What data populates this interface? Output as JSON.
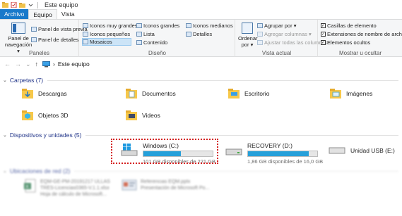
{
  "titlebar": {
    "title": "Este equipo"
  },
  "tabs": [
    {
      "label": "Archivo"
    },
    {
      "label": "Equipo"
    },
    {
      "label": "Vista"
    }
  ],
  "ribbon": {
    "paneles": {
      "label": "Paneles",
      "nav_pane": "Panel de navegación ▾",
      "preview": "Panel de vista previa",
      "details": "Panel de detalles"
    },
    "diseno": {
      "label": "Diseño",
      "items": [
        "Iconos muy grandes",
        "Iconos grandes",
        "Iconos medianos",
        "Iconos pequeños",
        "Lista",
        "Detalles",
        "Mosaicos",
        "Contenido"
      ]
    },
    "vista_actual": {
      "label": "Vista actual",
      "sort": "Ordenar por ▾",
      "group_by": "Agrupar por ▾",
      "add_columns": "Agregar columnas ▾",
      "fit_columns": "Ajustar todas las columnas"
    },
    "mostrar": {
      "label": "Mostrar u ocultar",
      "checkboxes": [
        {
          "label": "Casillas de elemento",
          "checked": true
        },
        {
          "label": "Extensiones de nombre de archivo",
          "checked": true
        },
        {
          "label": "Elementos ocultos",
          "checked": true
        }
      ]
    }
  },
  "address": {
    "path": "Este equipo"
  },
  "sections": {
    "folders": "Carpetas (7)",
    "drives": "Dispositivos y unidades (5)",
    "network": "Ubicaciones de red (2)"
  },
  "folders": [
    {
      "name": "Descargas",
      "icon": "downloads-folder-icon"
    },
    {
      "name": "Documentos",
      "icon": "documents-folder-icon"
    },
    {
      "name": "Escritorio",
      "icon": "desktop-folder-icon"
    },
    {
      "name": "Imágenes",
      "icon": "pictures-folder-icon"
    },
    {
      "name": "Objetos 3D",
      "icon": "3d-objects-folder-icon"
    },
    {
      "name": "Videos",
      "icon": "videos-folder-icon"
    }
  ],
  "drives": [
    {
      "name": "Windows (C:)",
      "free": "101 GB disponibles de 221 GB",
      "used_fraction": 0.54,
      "icon": "windows-drive-icon"
    },
    {
      "name": "RECOVERY (D:)",
      "free": "1,86 GB disponibles de 16,0 GB",
      "used_fraction": 0.88,
      "icon": "drive-icon"
    },
    {
      "name": "Unidad USB (E:)",
      "free": "",
      "used_fraction": null,
      "icon": "usb-drive-icon"
    }
  ],
  "network": [
    {
      "line1": "EQM-GE-PM-20191217 ULLAS",
      "line2": "TRES-Licencias0365-V.1.1.xlsx",
      "line3": "Hoja de cálculo de Microsoft...",
      "icon": "excel-icon"
    },
    {
      "line1": "Referencias EQM.pptx",
      "line2": "Presentación de Microsoft Po...",
      "line3": "",
      "icon": "powerpoint-icon"
    }
  ],
  "colors": {
    "file_tab": "#1979ca",
    "drive_fill": "#26a0da",
    "highlight": "#d42020",
    "section_text": "#1e3287"
  }
}
